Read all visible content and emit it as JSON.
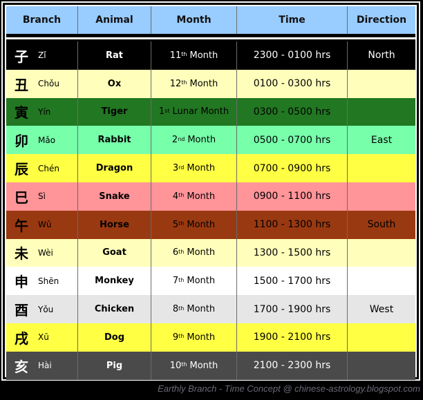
{
  "table": {
    "headers": [
      "Branch",
      "Animal",
      "Month",
      "Time",
      "Direction"
    ],
    "rows": [
      {
        "hanzi": "子",
        "pinyin": "Zǐ",
        "animal": "Rat",
        "month_num": "11",
        "month_suffix": "th",
        "month_label": "Month",
        "time": "2300  - 0100 hrs",
        "direction": "North",
        "bg": "#000000",
        "fg": "#ffffff"
      },
      {
        "hanzi": "丑",
        "pinyin": "Chǒu",
        "animal": "Ox",
        "month_num": "12",
        "month_suffix": "th",
        "month_label": "Month",
        "time": "0100  - 0300 hrs",
        "direction": "",
        "bg": "#ffffbb",
        "fg": "#000000"
      },
      {
        "hanzi": "寅",
        "pinyin": "Yín",
        "animal": "Tiger",
        "month_num": "1",
        "month_suffix": "st",
        "month_label": "Lunar Month",
        "time": "0300  - 0500 hrs",
        "direction": "",
        "bg": "#227722",
        "fg": "#000000"
      },
      {
        "hanzi": "卯",
        "pinyin": "Mǎo",
        "animal": "Rabbit",
        "month_num": "2",
        "month_suffix": "nd",
        "month_label": "Month",
        "time": "0500  - 0700 hrs",
        "direction": "East",
        "bg": "#77ffaa",
        "fg": "#000000"
      },
      {
        "hanzi": "辰",
        "pinyin": "Chén",
        "animal": "Dragon",
        "month_num": "3",
        "month_suffix": "rd",
        "month_label": "Month",
        "time": "0700  - 0900 hrs",
        "direction": "",
        "bg": "#ffff44",
        "fg": "#000000"
      },
      {
        "hanzi": "巳",
        "pinyin": "Sì",
        "animal": "Snake",
        "month_num": "4",
        "month_suffix": "th",
        "month_label": "Month",
        "time": "0900  - 1100 hrs",
        "direction": "",
        "bg": "#ff9499",
        "fg": "#000000"
      },
      {
        "hanzi": "午",
        "pinyin": "Wǔ",
        "animal": "Horse",
        "month_num": "5",
        "month_suffix": "th",
        "month_label": "Month",
        "time": "1100  - 1300 hrs",
        "direction": "South",
        "bg": "#993911",
        "fg": "#000000"
      },
      {
        "hanzi": "未",
        "pinyin": "Wèi",
        "animal": "Goat",
        "month_num": "6",
        "month_suffix": "th",
        "month_label": "Month",
        "time": "1300  - 1500 hrs",
        "direction": "",
        "bg": "#ffffbb",
        "fg": "#000000"
      },
      {
        "hanzi": "申",
        "pinyin": "Shēn",
        "animal": "Monkey",
        "month_num": "7",
        "month_suffix": "th",
        "month_label": "Month",
        "time": "1500  - 1700 hrs",
        "direction": "",
        "bg": "#ffffff",
        "fg": "#000000"
      },
      {
        "hanzi": "酉",
        "pinyin": "Yǒu",
        "animal": "Chicken",
        "month_num": "8",
        "month_suffix": "th",
        "month_label": "Month",
        "time": "1700  - 1900 hrs",
        "direction": "West",
        "bg": "#e6e6e6",
        "fg": "#000000"
      },
      {
        "hanzi": "戌",
        "pinyin": "Xū",
        "animal": "Dog",
        "month_num": "9",
        "month_suffix": "th",
        "month_label": "Month",
        "time": "1900  - 2100 hrs",
        "direction": "",
        "bg": "#ffff44",
        "fg": "#000000"
      },
      {
        "hanzi": "亥",
        "pinyin": "Hài",
        "animal": "Pig",
        "month_num": "10",
        "month_suffix": "th",
        "month_label": "Month",
        "time": "2100  - 2300 hrs",
        "direction": "",
        "bg": "#4a4a4a",
        "fg": "#ffffff"
      }
    ]
  },
  "footer": "Earthly Branch - Time Concept @ chinese-astrology.blogspot.com"
}
